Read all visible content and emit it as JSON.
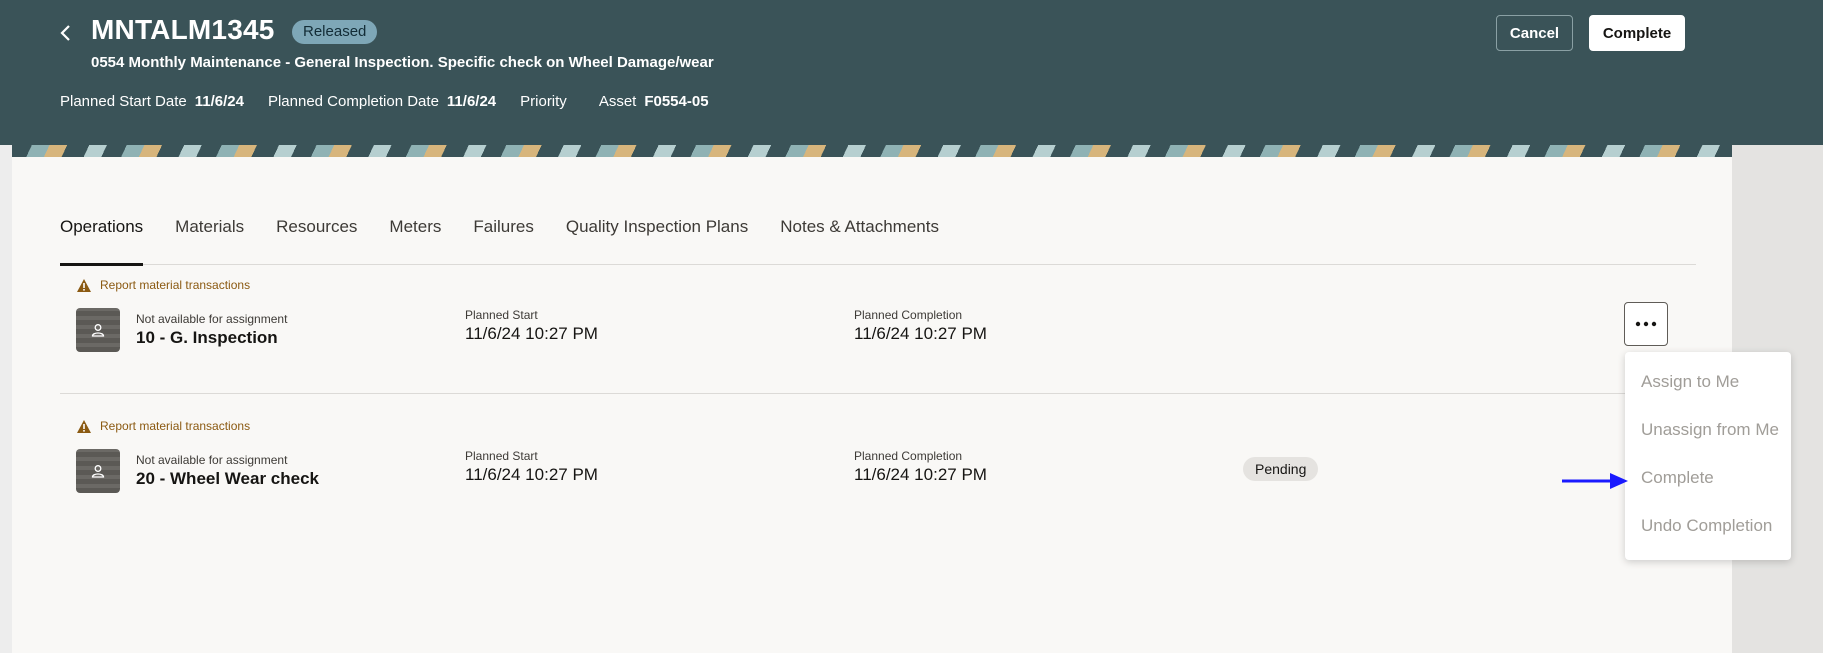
{
  "header": {
    "title": "MNTALM1345",
    "status": "Released",
    "subtitle": "0554 Monthly Maintenance - General Inspection. Specific check on Wheel Damage/wear",
    "meta": [
      {
        "label": "Planned Start Date",
        "value": "11/6/24"
      },
      {
        "label": "Planned Completion Date",
        "value": "11/6/24"
      },
      {
        "label": "Priority",
        "value": ""
      },
      {
        "label": "Asset",
        "value": "F0554-05"
      }
    ],
    "cancel_label": "Cancel",
    "complete_label": "Complete"
  },
  "tabs": [
    {
      "label": "Operations",
      "active": true
    },
    {
      "label": "Materials"
    },
    {
      "label": "Resources"
    },
    {
      "label": "Meters"
    },
    {
      "label": "Failures"
    },
    {
      "label": "Quality Inspection Plans"
    },
    {
      "label": "Notes & Attachments"
    }
  ],
  "operations": [
    {
      "warning": "Report material transactions",
      "assignment": "Not available for assignment",
      "name": "10 - G. Inspection",
      "planned_start_label": "Planned Start",
      "planned_start": "11/6/24 10:27 PM",
      "planned_completion_label": "Planned Completion",
      "planned_completion": "11/6/24 10:27 PM",
      "status": ""
    },
    {
      "warning": "Report material transactions",
      "assignment": "Not available for assignment",
      "name": "20 - Wheel Wear check",
      "planned_start_label": "Planned Start",
      "planned_start": "11/6/24 10:27 PM",
      "planned_completion_label": "Planned Completion",
      "planned_completion": "11/6/24 10:27 PM",
      "status": "Pending"
    }
  ],
  "menu": {
    "items": [
      "Assign to Me",
      "Unassign from Me",
      "Complete",
      "Undo Completion"
    ]
  },
  "colors": {
    "header_bg": "#3a5358",
    "badge_bg": "#7ea7b7",
    "warning": "#8b5a12",
    "arrow": "#1a1aff"
  },
  "icons": [
    "back-arrow-icon",
    "warning-icon",
    "person-icon",
    "more-icon"
  ]
}
